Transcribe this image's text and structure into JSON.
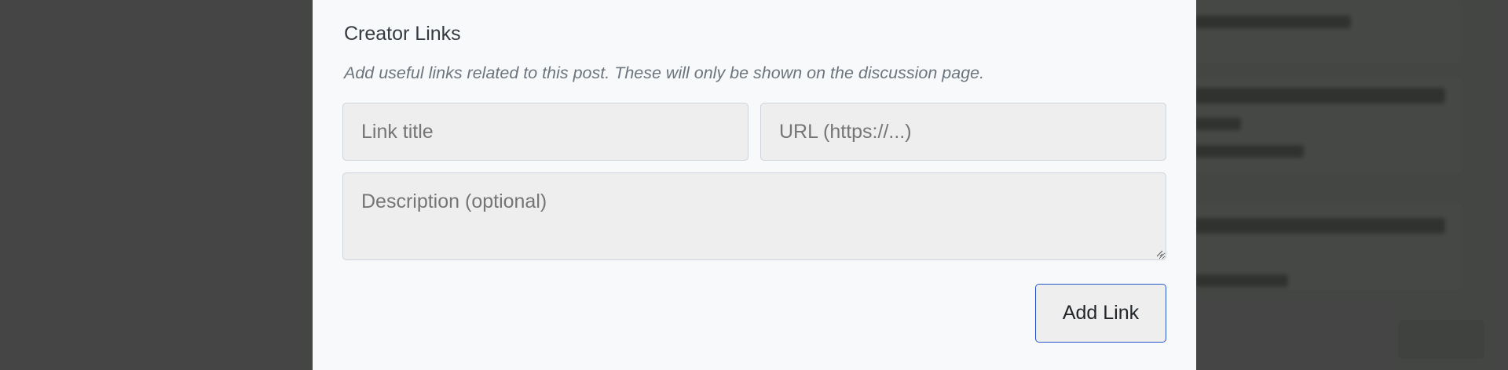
{
  "creator_links": {
    "title": "Creator Links",
    "help_text": "Add useful links related to this post. These will only be shown on the discussion page.",
    "link_title_placeholder": "Link title",
    "url_placeholder": "URL (https://...)",
    "description_placeholder": "Description (optional)",
    "add_button_label": "Add Link"
  },
  "colors": {
    "overlay": "#121412",
    "modal_background": "#f8f9fa",
    "input_background": "#eeeeee",
    "button_border_accent": "#2557c7"
  }
}
